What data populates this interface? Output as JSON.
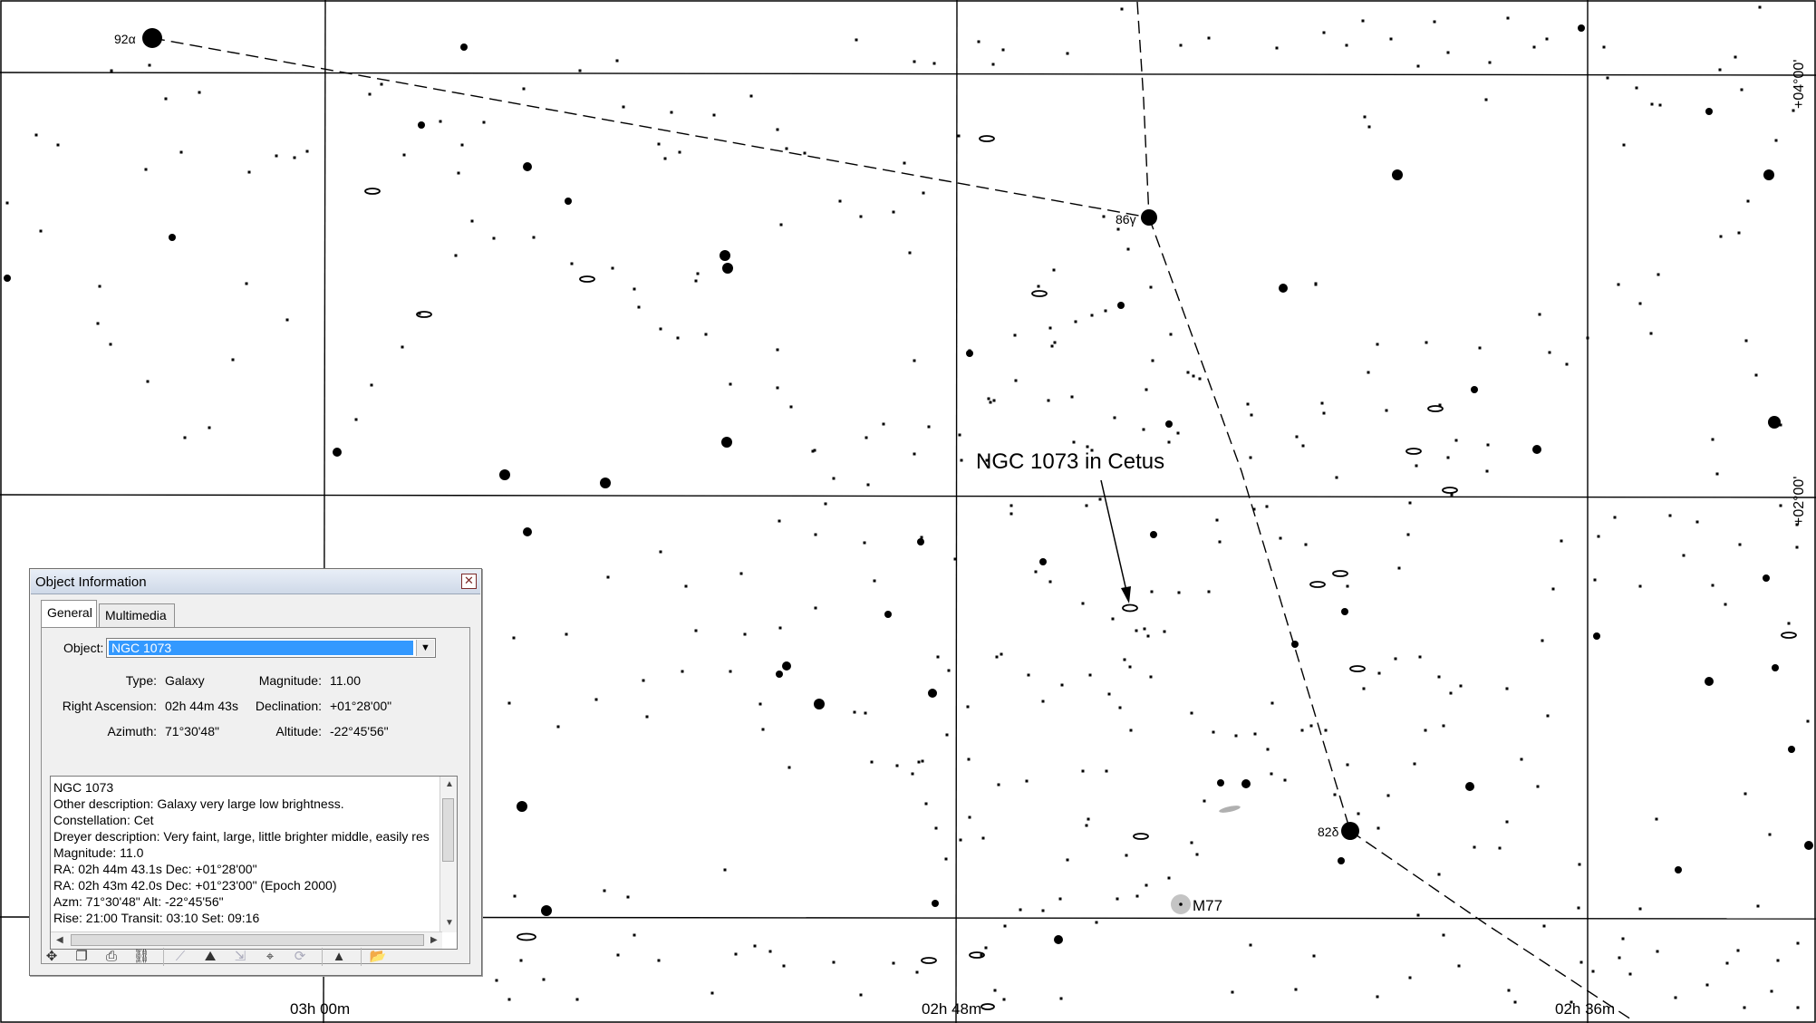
{
  "chart_labels": {
    "annotation": "NGC 1073 in Cetus",
    "ra_labels": [
      "03h 00m",
      "02h 48m",
      "02h 36m"
    ],
    "dec_labels": [
      "+04°00'",
      "+02°00'"
    ],
    "star_labels": [
      "92α",
      "86γ",
      "82δ"
    ],
    "messier_label": "M77"
  },
  "dialog": {
    "title": "Object Information",
    "close_symbol": "✕",
    "tabs": [
      "General",
      "Multimedia"
    ],
    "object_label": "Object:",
    "object_value": "NGC 1073",
    "fields": {
      "type_label": "Type:",
      "type_value": "Galaxy",
      "magnitude_label": "Magnitude:",
      "magnitude_value": "11.00",
      "ra_label": "Right Ascension:",
      "ra_value": "02h 44m 43s",
      "dec_label": "Declination:",
      "dec_value": "+01°28'00\"",
      "azimuth_label": "Azimuth:",
      "azimuth_value": "71°30'48\"",
      "altitude_label": "Altitude:",
      "altitude_value": "-22°45'56\""
    },
    "details": [
      "NGC 1073",
      "Other description: Galaxy very large low brightness.",
      "Constellation:  Cet",
      "Dreyer description: Very faint, large, little brighter middle, easily res",
      "Magnitude: 11.0",
      "RA: 02h 44m 43.1s  Dec: +01°28'00\"",
      "RA: 02h 43m 42.0s  Dec: +01°23'00\"  (Epoch 2000)",
      "Azm: 71°30'48\"  Alt: -22°45'56\"",
      "Rise: 21:00  Transit: 03:10  Set: 09:16"
    ],
    "toolbar_icons": [
      "center-icon",
      "copy-icon",
      "print-icon",
      "link-icon",
      "separator",
      "measure-icon",
      "horizon-icon",
      "slew-icon",
      "track-icon",
      "sync-icon",
      "separator",
      "up-icon",
      "separator",
      "open-folder-icon"
    ]
  }
}
